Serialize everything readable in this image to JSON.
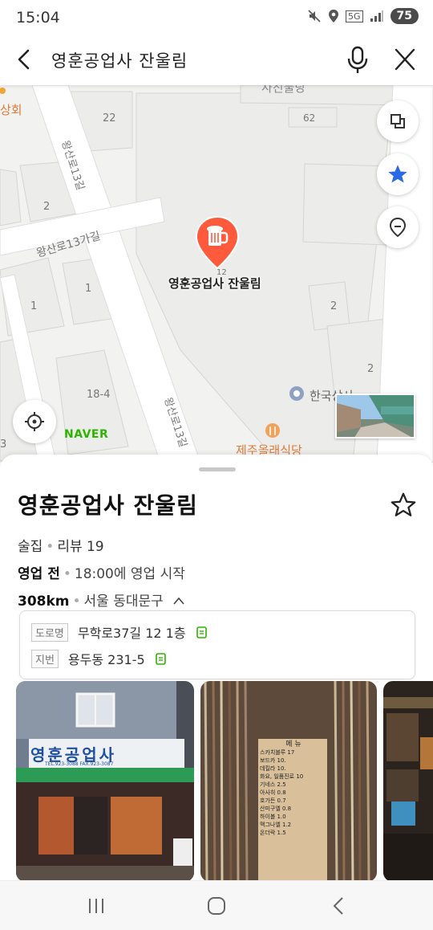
{
  "status": {
    "time": "15:04",
    "network": "5G",
    "battery": "75",
    "icons": [
      "mute-icon",
      "location-icon",
      "signal-icon",
      "battery-icon"
    ]
  },
  "search": {
    "query": "영훈공업사 잔울림"
  },
  "map": {
    "road_labels": [
      "왕산로13길",
      "왕산로13가길",
      "왕산로13길"
    ],
    "building_numbers": [
      "22",
      "62",
      "2",
      "1",
      "1",
      "18-4",
      "2",
      "2",
      "12",
      "3",
      "2"
    ],
    "poi_labels": [
      "상회",
      "사진불당",
      "한국상사",
      "제주올래식당"
    ],
    "place_label": "영훈공업사 잔울림",
    "logo": "NAVER",
    "accent_color": "#ff5a3c"
  },
  "place": {
    "title": "영훈공업사 잔울림",
    "category": "술집",
    "review_label": "리뷰 19",
    "business_status": "영업 전",
    "business_hours": "18:00에 영업 시작",
    "distance": "308km",
    "region": "서울 동대문구",
    "address": {
      "road_tag": "도로명",
      "road": "무학로37길 12 1층",
      "lot_tag": "지번",
      "lot": "용두동 231-5"
    }
  },
  "photos": {
    "sign_title": "영훈공업사",
    "sign_small": "TEL.923-3088  FAX.923-3087",
    "menu_header": "메 뉴",
    "menu_items": [
      "스카치블루 17",
      "보드카 10.",
      "데킬라 10.",
      "화요, 일품진로 10",
      "기네스 2.5",
      "아사히 0.8",
      "호가든 0.7",
      "산미구엘 0.8",
      "하이볼 1.0",
      "맥그나엘 1.2",
      "온더락 1.5"
    ]
  }
}
